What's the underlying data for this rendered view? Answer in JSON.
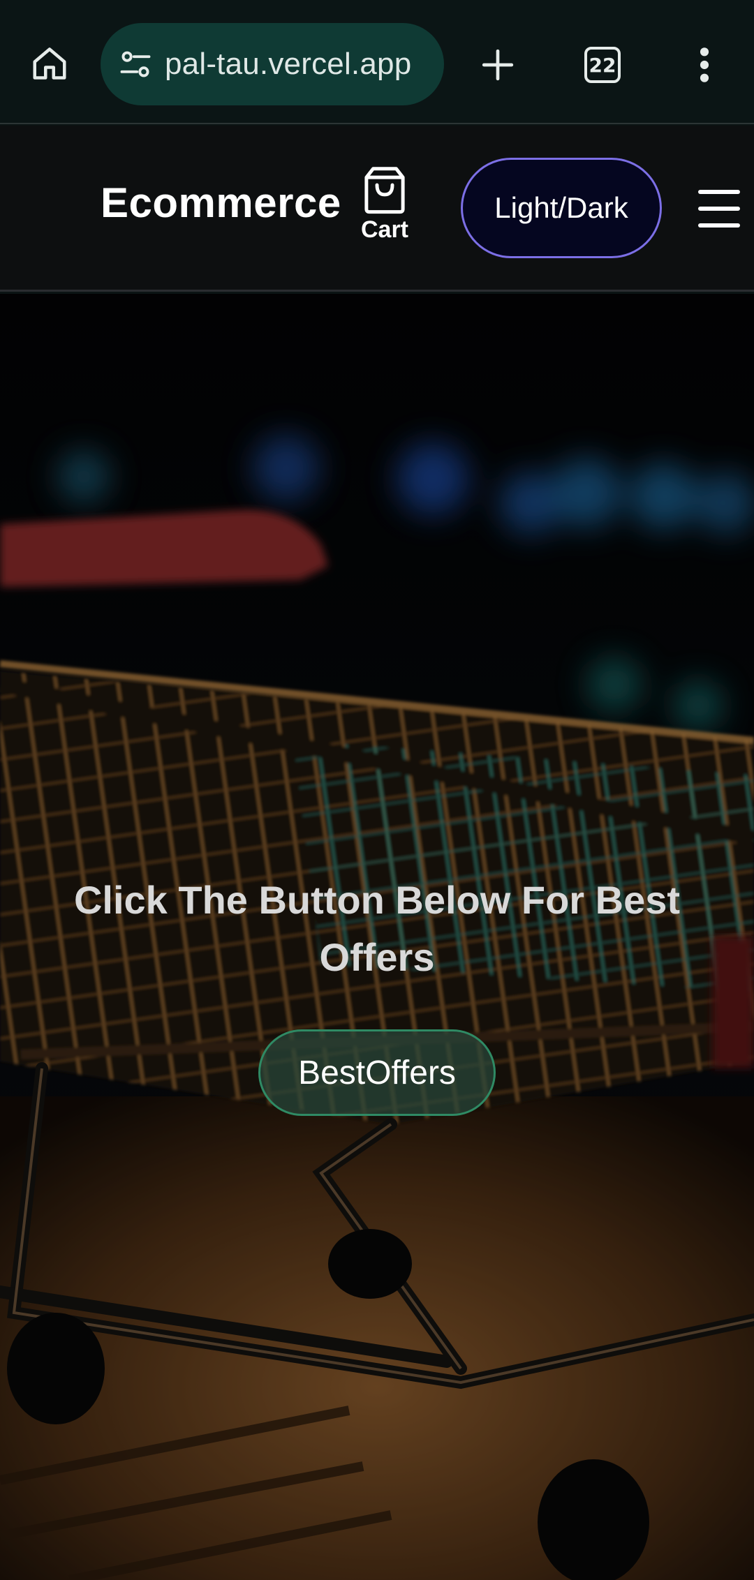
{
  "browser": {
    "url": "pal-tau.vercel.app",
    "tab_count": "22",
    "icons": {
      "home": "home-icon",
      "site_settings": "tune-icon",
      "new_tab": "plus-icon",
      "tabs": "tabs-icon",
      "menu": "more-vert-icon"
    }
  },
  "header": {
    "brand": "Ecommerce",
    "cart_label": "Cart",
    "theme_toggle_label": "Light/Dark",
    "cart_icon": "shopping-bag-icon",
    "menu_icon": "hamburger-menu-icon"
  },
  "hero": {
    "title": "Click The Button Below For Best Offers",
    "button_label": "BestOffers",
    "background": "shopping-cart-photo"
  },
  "colors": {
    "browser_bg": "#0b1515",
    "address_pill": "#0f3a34",
    "header_bg": "#0d0f10",
    "toggle_border": "#7c6fe6",
    "toggle_bg": "#050620",
    "offers_border": "#2f8a64"
  }
}
